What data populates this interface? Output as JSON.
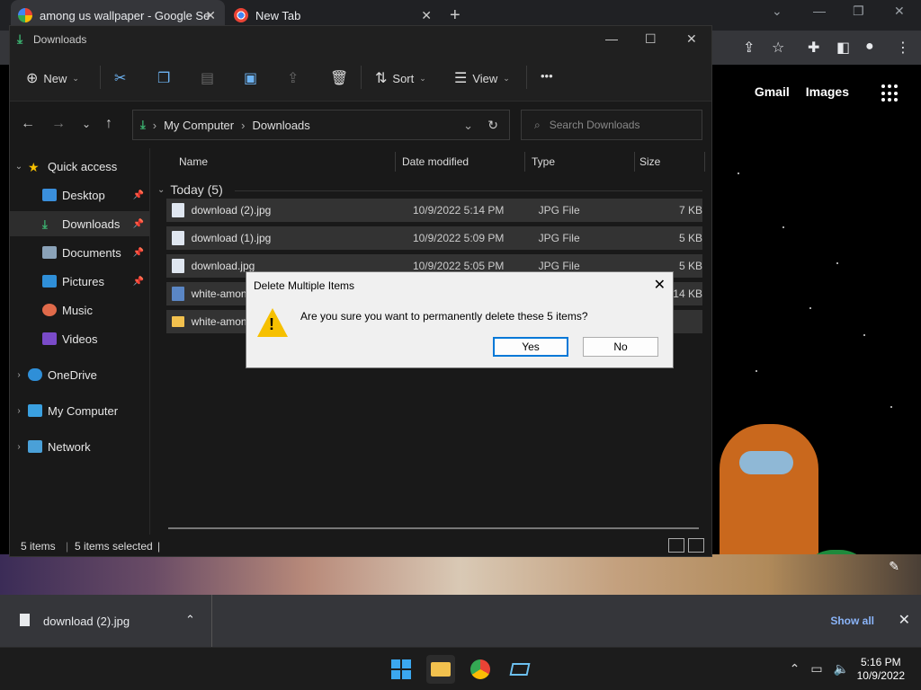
{
  "chrome": {
    "tabs": [
      {
        "title": "among us wallpaper - Google Se",
        "icon": "google-icon"
      },
      {
        "title": "New Tab",
        "icon": "chrome-icon"
      }
    ],
    "new_tab_label": "+",
    "page": {
      "links": [
        "Gmail",
        "Images"
      ]
    }
  },
  "explorer": {
    "title": "Downloads",
    "commands": {
      "new": "New",
      "sort": "Sort",
      "view": "View",
      "more": "•••"
    },
    "address": {
      "parts": [
        "My Computer",
        "Downloads"
      ]
    },
    "search_placeholder": "Search Downloads",
    "nav": [
      {
        "label": "Quick access",
        "icon": "star-icon"
      },
      {
        "label": "Desktop",
        "icon": "desktop-icon"
      },
      {
        "label": "Downloads",
        "icon": "download-icon"
      },
      {
        "label": "Documents",
        "icon": "documents-icon"
      },
      {
        "label": "Pictures",
        "icon": "pictures-icon"
      },
      {
        "label": "Music",
        "icon": "music-icon"
      },
      {
        "label": "Videos",
        "icon": "videos-icon"
      },
      {
        "label": "OneDrive",
        "icon": "cloud-icon"
      },
      {
        "label": "My Computer",
        "icon": "computer-icon"
      },
      {
        "label": "Network",
        "icon": "network-icon"
      }
    ],
    "columns": [
      "Name",
      "Date modified",
      "Type",
      "Size"
    ],
    "group": "Today (5)",
    "files": [
      {
        "name": "download (2).jpg",
        "date": "10/9/2022 5:14 PM",
        "type": "JPG File",
        "size": "7 KB"
      },
      {
        "name": "download (1).jpg",
        "date": "10/9/2022 5:09 PM",
        "type": "JPG File",
        "size": "5 KB"
      },
      {
        "name": "download.jpg",
        "date": "10/9/2022 5:05 PM",
        "type": "JPG File",
        "size": "5 KB"
      },
      {
        "name": "white-among",
        "date": "",
        "type": "",
        "size": "14 KB"
      },
      {
        "name": "white-among",
        "date": "",
        "type": "",
        "size": ""
      }
    ],
    "status": {
      "count": "5 items",
      "selected": "5 items selected"
    }
  },
  "dialog": {
    "title": "Delete Multiple Items",
    "message": "Are you sure you want to permanently delete these 5 items?",
    "yes": "Yes",
    "no": "No"
  },
  "download_shelf": {
    "file": "download (2).jpg",
    "show_all": "Show all"
  },
  "taskbar": {
    "time": "5:16 PM",
    "date": "10/9/2022"
  }
}
